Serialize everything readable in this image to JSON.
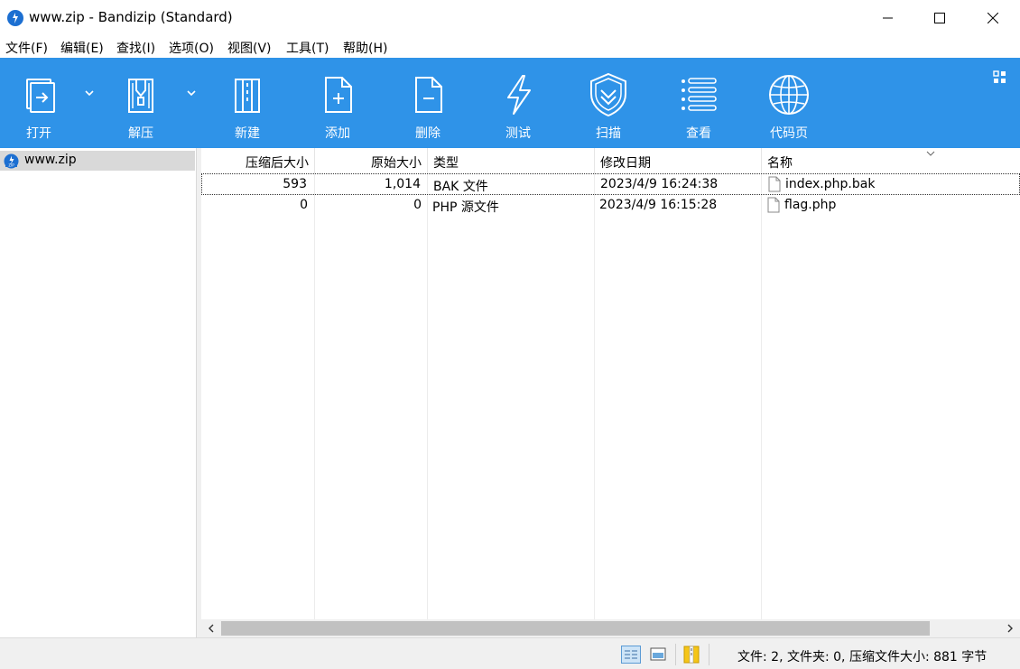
{
  "window": {
    "title": "www.zip - Bandizip (Standard)"
  },
  "menu": [
    {
      "label": "文件(F)"
    },
    {
      "label": "编辑(E)"
    },
    {
      "label": "查找(I)"
    },
    {
      "label": "选项(O)"
    },
    {
      "label": "视图(V)"
    },
    {
      "label": "工具(T)"
    },
    {
      "label": "帮助(H)"
    }
  ],
  "toolbar": {
    "background": "#2f93e8",
    "items": [
      {
        "label": "打开",
        "icon": "open-icon"
      },
      {
        "label": "解压",
        "icon": "extract-icon"
      },
      {
        "label": "新建",
        "icon": "new-archive-icon"
      },
      {
        "label": "添加",
        "icon": "add-file-icon"
      },
      {
        "label": "删除",
        "icon": "delete-file-icon"
      },
      {
        "label": "测试",
        "icon": "lightning-icon"
      },
      {
        "label": "扫描",
        "icon": "shield-icon"
      },
      {
        "label": "查看",
        "icon": "list-view-icon"
      },
      {
        "label": "代码页",
        "icon": "globe-icon"
      }
    ]
  },
  "tree": {
    "items": [
      {
        "label": "www.zip"
      }
    ]
  },
  "filelist": {
    "columns": [
      "压缩后大小",
      "原始大小",
      "类型",
      "修改日期",
      "名称"
    ],
    "rows": [
      {
        "compressed": "593",
        "original": "1,014",
        "type": "BAK 文件",
        "modified": "2023/4/9 16:24:38",
        "name": "index.php.bak",
        "selected": true
      },
      {
        "compressed": "0",
        "original": "0",
        "type": "PHP 源文件",
        "modified": "2023/4/9 16:15:28",
        "name": "flag.php",
        "selected": false
      }
    ]
  },
  "status": {
    "text": "文件: 2, 文件夹: 0, 压缩文件大小: 881 字节"
  }
}
